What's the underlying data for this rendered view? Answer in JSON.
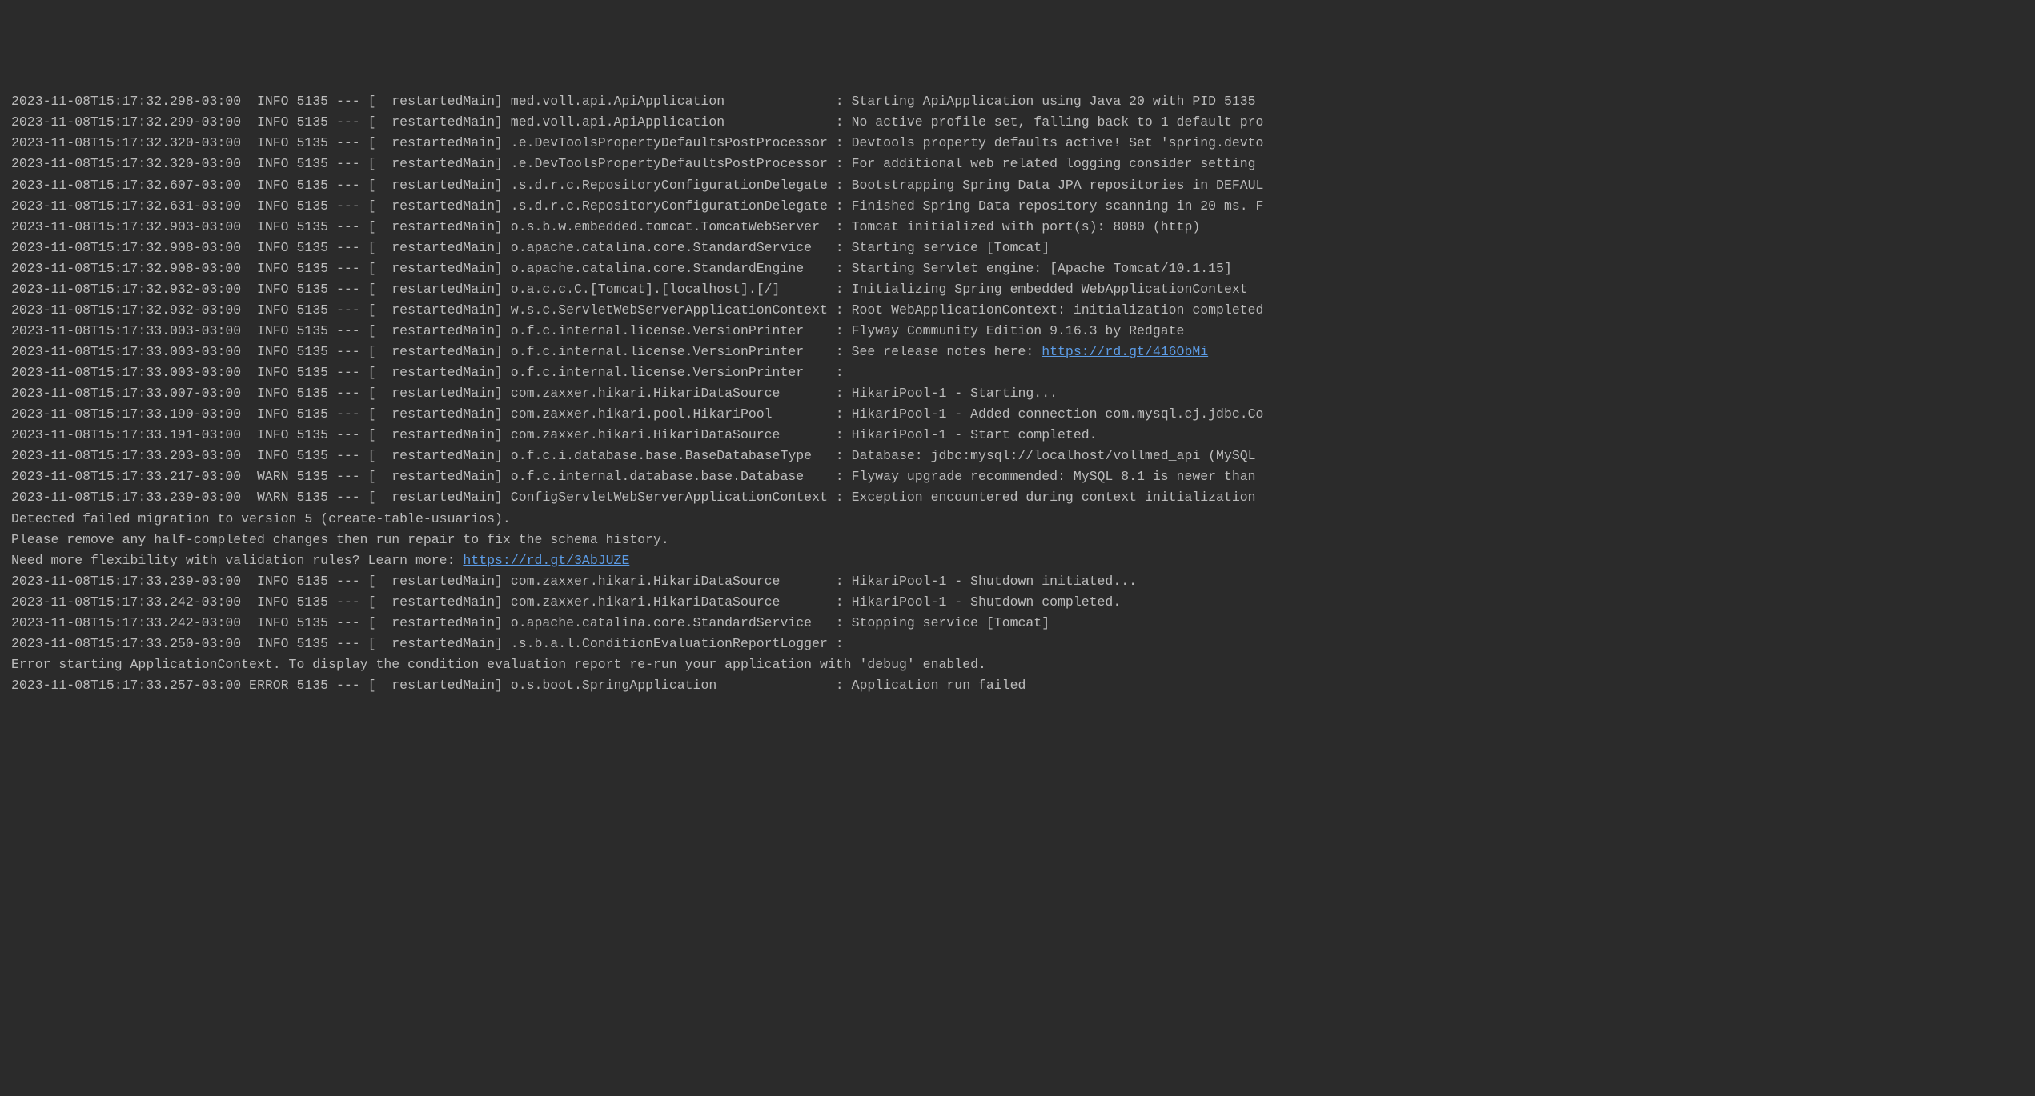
{
  "log": {
    "lines": [
      {
        "type": "plain",
        "text": "2023-11-08T15:17:32.298-03:00  INFO 5135 --- [  restartedMain] med.voll.api.ApiApplication              : Starting ApiApplication using Java 20 with PID 5135"
      },
      {
        "type": "plain",
        "text": "2023-11-08T15:17:32.299-03:00  INFO 5135 --- [  restartedMain] med.voll.api.ApiApplication              : No active profile set, falling back to 1 default pro"
      },
      {
        "type": "plain",
        "text": "2023-11-08T15:17:32.320-03:00  INFO 5135 --- [  restartedMain] .e.DevToolsPropertyDefaultsPostProcessor : Devtools property defaults active! Set 'spring.devto"
      },
      {
        "type": "plain",
        "text": "2023-11-08T15:17:32.320-03:00  INFO 5135 --- [  restartedMain] .e.DevToolsPropertyDefaultsPostProcessor : For additional web related logging consider setting "
      },
      {
        "type": "plain",
        "text": "2023-11-08T15:17:32.607-03:00  INFO 5135 --- [  restartedMain] .s.d.r.c.RepositoryConfigurationDelegate : Bootstrapping Spring Data JPA repositories in DEFAUL"
      },
      {
        "type": "plain",
        "text": "2023-11-08T15:17:32.631-03:00  INFO 5135 --- [  restartedMain] .s.d.r.c.RepositoryConfigurationDelegate : Finished Spring Data repository scanning in 20 ms. F"
      },
      {
        "type": "plain",
        "text": "2023-11-08T15:17:32.903-03:00  INFO 5135 --- [  restartedMain] o.s.b.w.embedded.tomcat.TomcatWebServer  : Tomcat initialized with port(s): 8080 (http)"
      },
      {
        "type": "plain",
        "text": "2023-11-08T15:17:32.908-03:00  INFO 5135 --- [  restartedMain] o.apache.catalina.core.StandardService   : Starting service [Tomcat]"
      },
      {
        "type": "plain",
        "text": "2023-11-08T15:17:32.908-03:00  INFO 5135 --- [  restartedMain] o.apache.catalina.core.StandardEngine    : Starting Servlet engine: [Apache Tomcat/10.1.15]"
      },
      {
        "type": "plain",
        "text": "2023-11-08T15:17:32.932-03:00  INFO 5135 --- [  restartedMain] o.a.c.c.C.[Tomcat].[localhost].[/]       : Initializing Spring embedded WebApplicationContext"
      },
      {
        "type": "plain",
        "text": "2023-11-08T15:17:32.932-03:00  INFO 5135 --- [  restartedMain] w.s.c.ServletWebServerApplicationContext : Root WebApplicationContext: initialization completed"
      },
      {
        "type": "plain",
        "text": "2023-11-08T15:17:33.003-03:00  INFO 5135 --- [  restartedMain] o.f.c.internal.license.VersionPrinter    : Flyway Community Edition 9.16.3 by Redgate"
      },
      {
        "type": "link",
        "prefix": "2023-11-08T15:17:33.003-03:00  INFO 5135 --- [  restartedMain] o.f.c.internal.license.VersionPrinter    : See release notes here: ",
        "linkText": "https://rd.gt/416ObMi",
        "suffix": ""
      },
      {
        "type": "plain",
        "text": "2023-11-08T15:17:33.003-03:00  INFO 5135 --- [  restartedMain] o.f.c.internal.license.VersionPrinter    : "
      },
      {
        "type": "plain",
        "text": "2023-11-08T15:17:33.007-03:00  INFO 5135 --- [  restartedMain] com.zaxxer.hikari.HikariDataSource       : HikariPool-1 - Starting..."
      },
      {
        "type": "plain",
        "text": "2023-11-08T15:17:33.190-03:00  INFO 5135 --- [  restartedMain] com.zaxxer.hikari.pool.HikariPool        : HikariPool-1 - Added connection com.mysql.cj.jdbc.Co"
      },
      {
        "type": "plain",
        "text": "2023-11-08T15:17:33.191-03:00  INFO 5135 --- [  restartedMain] com.zaxxer.hikari.HikariDataSource       : HikariPool-1 - Start completed."
      },
      {
        "type": "plain",
        "text": "2023-11-08T15:17:33.203-03:00  INFO 5135 --- [  restartedMain] o.f.c.i.database.base.BaseDatabaseType   : Database: jdbc:mysql://localhost/vollmed_api (MySQL "
      },
      {
        "type": "plain",
        "text": "2023-11-08T15:17:33.217-03:00  WARN 5135 --- [  restartedMain] o.f.c.internal.database.base.Database    : Flyway upgrade recommended: MySQL 8.1 is newer than "
      },
      {
        "type": "plain",
        "text": "2023-11-08T15:17:33.239-03:00  WARN 5135 --- [  restartedMain] ConfigServletWebServerApplicationContext : Exception encountered during context initialization "
      },
      {
        "type": "plain",
        "text": "Detected failed migration to version 5 (create-table-usuarios)."
      },
      {
        "type": "plain",
        "text": "Please remove any half-completed changes then run repair to fix the schema history."
      },
      {
        "type": "link",
        "prefix": "Need more flexibility with validation rules? Learn more: ",
        "linkText": "https://rd.gt/3AbJUZE",
        "suffix": ""
      },
      {
        "type": "plain",
        "text": "2023-11-08T15:17:33.239-03:00  INFO 5135 --- [  restartedMain] com.zaxxer.hikari.HikariDataSource       : HikariPool-1 - Shutdown initiated..."
      },
      {
        "type": "plain",
        "text": "2023-11-08T15:17:33.242-03:00  INFO 5135 --- [  restartedMain] com.zaxxer.hikari.HikariDataSource       : HikariPool-1 - Shutdown completed."
      },
      {
        "type": "plain",
        "text": "2023-11-08T15:17:33.242-03:00  INFO 5135 --- [  restartedMain] o.apache.catalina.core.StandardService   : Stopping service [Tomcat]"
      },
      {
        "type": "plain",
        "text": "2023-11-08T15:17:33.250-03:00  INFO 5135 --- [  restartedMain] .s.b.a.l.ConditionEvaluationReportLogger : "
      },
      {
        "type": "plain",
        "text": ""
      },
      {
        "type": "plain",
        "text": "Error starting ApplicationContext. To display the condition evaluation report re-run your application with 'debug' enabled."
      },
      {
        "type": "plain",
        "text": "2023-11-08T15:17:33.257-03:00 ERROR 5135 --- [  restartedMain] o.s.boot.SpringApplication               : Application run failed"
      }
    ]
  }
}
